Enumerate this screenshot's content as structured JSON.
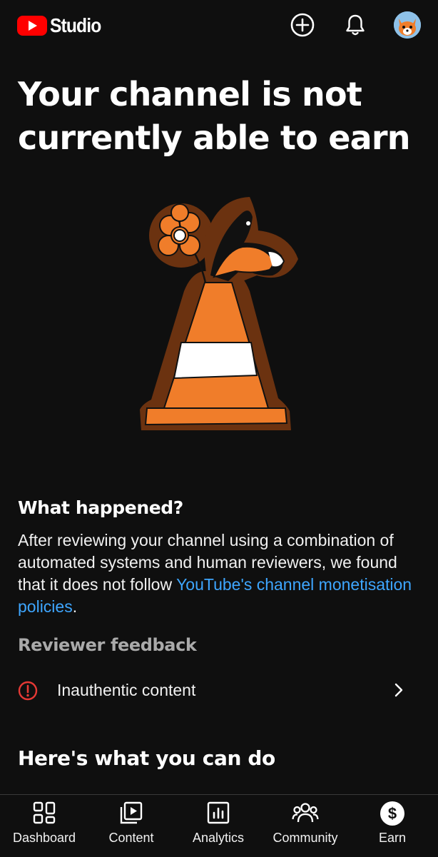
{
  "header": {
    "app_name": "Studio",
    "icons": [
      "youtube-logo-icon",
      "create-plus-icon",
      "notifications-bell-icon",
      "account-avatar"
    ]
  },
  "main": {
    "title": "Your channel is not currently able to earn",
    "what_happened": {
      "heading": "What happened?",
      "body_prefix": "After reviewing your channel using a combination of automated systems and human reviewers, we found that it does not follow ",
      "link_text": "YouTube's channel monetisation policies",
      "body_suffix": "."
    },
    "reviewer_feedback": {
      "heading": "Reviewer feedback",
      "items": [
        {
          "label": "Inauthentic content",
          "icon": "alert-circle-icon"
        }
      ]
    },
    "what_you_can_do": {
      "heading": "Here's what you can do"
    }
  },
  "bottom_nav": {
    "items": [
      {
        "label": "Dashboard",
        "icon": "dashboard-icon"
      },
      {
        "label": "Content",
        "icon": "content-icon"
      },
      {
        "label": "Analytics",
        "icon": "analytics-icon"
      },
      {
        "label": "Community",
        "icon": "community-icon"
      },
      {
        "label": "Earn",
        "icon": "earn-dollar-icon",
        "selected": true
      }
    ]
  },
  "colors": {
    "background": "#0f0f0f",
    "text": "#f1f1f1",
    "muted": "#aaaaaa",
    "link": "#3ea6ff",
    "alert": "#e53935",
    "youtube_red": "#ff0000",
    "cone_orange": "#f07d2a",
    "cone_outline": "#6b3210"
  }
}
